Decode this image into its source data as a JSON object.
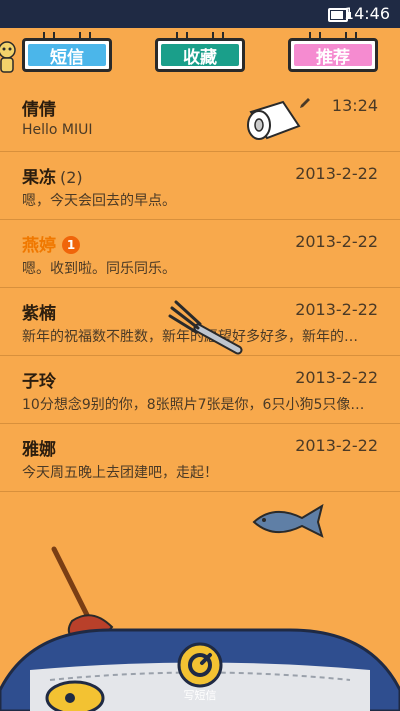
{
  "status": {
    "time": "14:46"
  },
  "tabs": [
    {
      "label": "短信"
    },
    {
      "label": "收藏"
    },
    {
      "label": "推荐"
    }
  ],
  "conversations": [
    {
      "name": "倩倩",
      "count": "",
      "preview": "Hello MIUI",
      "date": "13:24",
      "unread": "",
      "draft": true
    },
    {
      "name": "果冻",
      "count": "(2)",
      "preview": "嗯，今天会回去的早点。",
      "date": "2013-2-22",
      "unread": "",
      "draft": false
    },
    {
      "name": "燕婷",
      "count": "",
      "preview": "嗯。收到啦。同乐同乐。",
      "date": "2013-2-22",
      "unread": "1",
      "draft": false
    },
    {
      "name": "紫楠",
      "count": "",
      "preview": "新年的祝福数不胜数，新年的愿望好多好多，新年的…",
      "date": "2013-2-22",
      "unread": "",
      "draft": false
    },
    {
      "name": "子玲",
      "count": "",
      "preview": "10分想念9别的你，8张照片7张是你，6只小狗5只像…",
      "date": "2013-2-22",
      "unread": "",
      "draft": false
    },
    {
      "name": "雅娜",
      "count": "",
      "preview": "今天周五晚上去团建吧，走起！",
      "date": "2013-2-22",
      "unread": "",
      "draft": false
    }
  ],
  "compose": {
    "label": "写短信"
  },
  "colors": {
    "background": "#f8a94c",
    "tab_sms": "#4bb6ea",
    "tab_fav": "#1a9f8a",
    "tab_rec": "#f58bd0",
    "unread": "#f07800"
  }
}
